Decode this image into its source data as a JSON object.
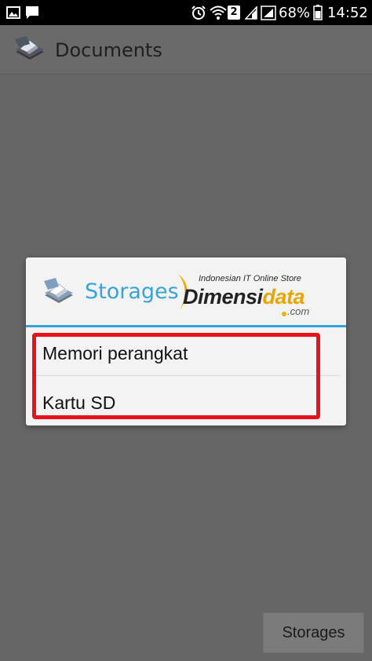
{
  "status_bar": {
    "battery": "68%",
    "time": "14:52",
    "sim_slot": "2"
  },
  "app_bar": {
    "title": "Documents"
  },
  "dialog": {
    "title": "Storages",
    "options": [
      {
        "label": "Memori perangkat"
      },
      {
        "label": "Kartu SD"
      }
    ]
  },
  "watermark": {
    "tagline": "Indonesian IT Online Store",
    "name_dark": "Dimensi",
    "name_accent": "data",
    "tld": ".com"
  },
  "footer": {
    "button_label": "Storages"
  },
  "colors": {
    "accent": "#36a3db",
    "highlight": "#e8121b",
    "brand_orange": "#e8a400"
  }
}
